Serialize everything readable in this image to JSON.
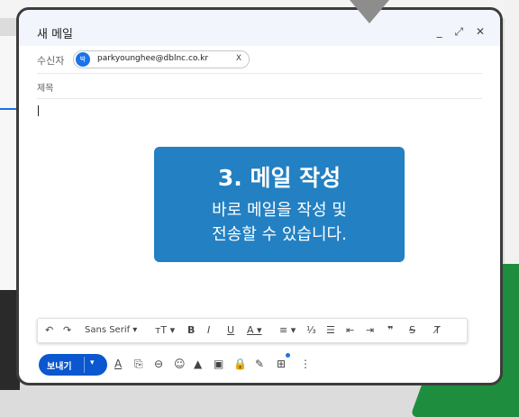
{
  "compose": {
    "title": "새 메일",
    "controls": {
      "minimize": "_",
      "expand": "⤢",
      "close": "✕"
    },
    "to_label": "수신자",
    "recipient": {
      "avatar": "박",
      "email": "parkyounghee@dblnc.co.kr",
      "remove": "X"
    },
    "subject_label": "제목"
  },
  "callout": {
    "title": "3. 메일 작성",
    "line1": "바로 메일을 작성 및",
    "line2": "전송할 수 있습니다."
  },
  "format_toolbar": {
    "undo": "↶",
    "redo": "↷",
    "font": "Sans Serif ▾",
    "size": "ᴛT ▾",
    "bold": "B",
    "italic": "I",
    "underline": "U",
    "text_color": "A ▾",
    "align": "≡ ▾",
    "numbered": "⅓",
    "bulleted": "☰",
    "indent_less": "⇤",
    "indent_more": "⇥",
    "quote": "❞",
    "strike": "S",
    "clear": "T̸"
  },
  "bottom_toolbar": {
    "send": "보내기",
    "send_options": "▾",
    "icons": [
      "A",
      "⎘",
      "⊖",
      "☺",
      "▲",
      "▣",
      "🔒",
      "✎",
      "⊞",
      "⋮"
    ]
  },
  "colors": {
    "accent": "#2380c2",
    "send": "#0b57d0",
    "green": "#1e8e3e"
  }
}
